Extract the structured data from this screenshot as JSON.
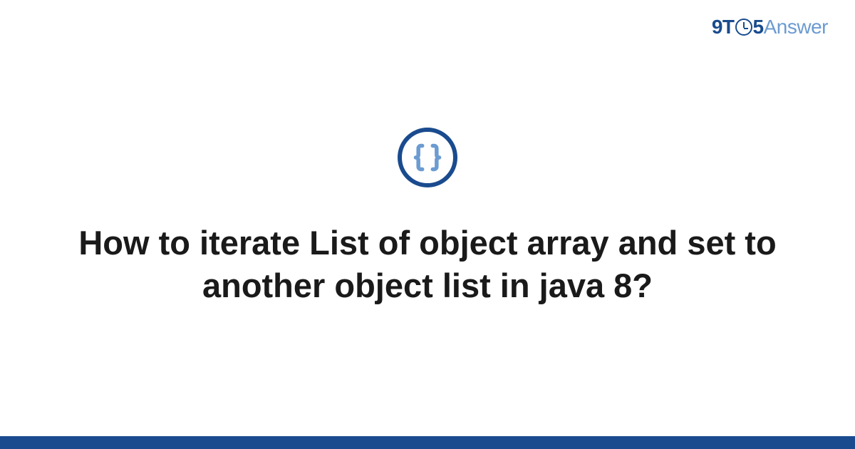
{
  "logo": {
    "part1": "9T",
    "part2": "5",
    "part3": "Answer"
  },
  "icon": {
    "name": "braces-icon"
  },
  "question": {
    "title": "How to iterate List of object array and set to another object list in java 8?"
  },
  "colors": {
    "primary": "#1a4b8e",
    "secondary": "#6b9bd1"
  }
}
